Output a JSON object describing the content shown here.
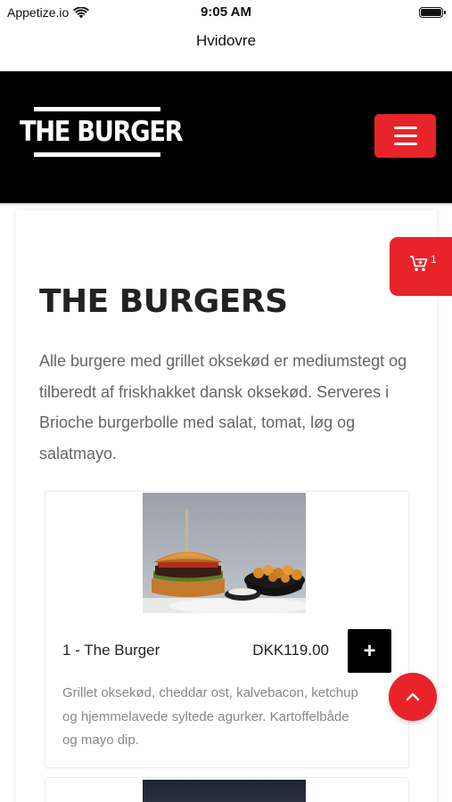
{
  "status_bar": {
    "carrier": "Appetize.io",
    "time": "9:05 AM"
  },
  "browser": {
    "url_title": "Hvidovre"
  },
  "header": {
    "logo_text": "THE BURGER",
    "menu_icon": "hamburger-menu-icon"
  },
  "cart": {
    "icon": "cart-add-icon",
    "count": "1"
  },
  "page": {
    "title": "THE BURGERS",
    "description": "Alle burgere med grillet oksekød er mediumstegt og tilberedt af friskhakket dansk oksekød. Serveres i Brioche burgerbolle med salat, tomat, løg og salatmayo."
  },
  "products": [
    {
      "name": "1 - The Burger",
      "price": "DKK119.00",
      "add_label": "+",
      "description": "Grillet oksekød, cheddar ost, kalvebacon, ketchup og hjemmelavede syltede agurker. Kartoffelbåde og mayo dip."
    }
  ],
  "colors": {
    "accent": "#e8232a",
    "header_bg": "#000000",
    "text_muted": "#666666"
  }
}
